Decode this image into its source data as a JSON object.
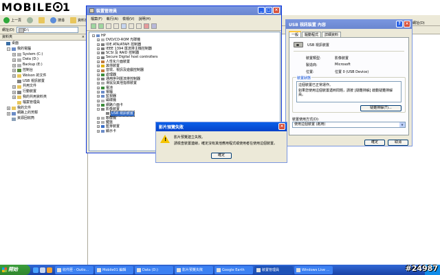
{
  "logo": {
    "text_left": "MOBILE",
    "text_right": "1"
  },
  "explorer": {
    "back": "上一頁",
    "search": "搜尋",
    "folders": "資料夾",
    "address_label": "網址(D)",
    "address_value": "D:\\",
    "pane_title": "資料夾",
    "pane_close": "×",
    "tree": [
      {
        "label": "桌面",
        "indent": 0,
        "box": "",
        "color": "#3a6ea5"
      },
      {
        "label": "我的電腦",
        "indent": 1,
        "box": "−",
        "color": "#6b8cc7"
      },
      {
        "label": "System (C:)",
        "indent": 2,
        "box": "+",
        "color": "#b0b0b0"
      },
      {
        "label": "Data (D:)",
        "indent": 2,
        "box": "+",
        "color": "#b0b0b0"
      },
      {
        "label": "Backup (E:)",
        "indent": 2,
        "box": "+",
        "color": "#b0b0b0"
      },
      {
        "label": "控制台",
        "indent": 2,
        "box": "+",
        "color": "#5b8c3a"
      },
      {
        "label": "Wolson 的文件",
        "indent": 2,
        "box": "+",
        "color": "#e8c65c"
      },
      {
        "label": "USB 視訊裝置",
        "indent": 2,
        "box": "",
        "color": "#808080"
      },
      {
        "label": "共用文件",
        "indent": 2,
        "box": "+",
        "color": "#e8c65c"
      },
      {
        "label": "行動裝置",
        "indent": 2,
        "box": "+",
        "color": "#808080"
      },
      {
        "label": "我的共用資料夾",
        "indent": 2,
        "box": "+",
        "color": "#e8c65c"
      },
      {
        "label": "檔案管理員",
        "indent": 2,
        "box": "",
        "color": "#e8c65c"
      },
      {
        "label": "我的文件",
        "indent": 1,
        "box": "+",
        "color": "#e8c65c"
      },
      {
        "label": "網路上的芳鄰",
        "indent": 1,
        "box": "+",
        "color": "#6b8cc7"
      },
      {
        "label": "資源回收筒",
        "indent": 1,
        "box": "",
        "color": "#8aa0b8"
      }
    ]
  },
  "device_manager": {
    "title": "裝置管理員",
    "menu": [
      "檔案(F)",
      "執行(A)",
      "檢視(V)",
      "說明(H)"
    ],
    "tree": [
      {
        "label": "HP",
        "indent": 0,
        "box": "−",
        "color": "#6b8cc7"
      },
      {
        "label": "DVD/CD-ROM 光碟機",
        "indent": 1,
        "box": "+",
        "color": "#b0b0b0"
      },
      {
        "label": "IDE ATA/ATAPI 控制器",
        "indent": 1,
        "box": "+",
        "color": "#7d7d7d"
      },
      {
        "label": "IEEE 1394 匯流排主機控制器",
        "indent": 1,
        "box": "+",
        "color": "#7d7d7d"
      },
      {
        "label": "SCSI 及 RAID 控制器",
        "indent": 1,
        "box": "+",
        "color": "#7d7d7d"
      },
      {
        "label": "Secure Digital host controllers",
        "indent": 1,
        "box": "+",
        "color": "#7d7d7d"
      },
      {
        "label": "人性化介面裝置",
        "indent": 1,
        "box": "+",
        "color": "#c07a3c"
      },
      {
        "label": "其他裝置",
        "indent": 1,
        "box": "+",
        "color": "#e0b000"
      },
      {
        "label": "音效、視訊及遊戲控制器",
        "indent": 1,
        "box": "+",
        "color": "#c07a3c"
      },
      {
        "label": "處理器",
        "indent": 1,
        "box": "+",
        "color": "#3a8c3a"
      },
      {
        "label": "通用序列匯流排控制器",
        "indent": 1,
        "box": "+",
        "color": "#7d7d7d"
      },
      {
        "label": "滑鼠及其他指標裝置",
        "indent": 1,
        "box": "+",
        "color": "#b0b0b0"
      },
      {
        "label": "電池",
        "indent": 1,
        "box": "+",
        "color": "#3a8c3a"
      },
      {
        "label": "電腦",
        "indent": 1,
        "box": "+",
        "color": "#6b8cc7"
      },
      {
        "label": "監視器",
        "indent": 1,
        "box": "+",
        "color": "#6b8cc7"
      },
      {
        "label": "磁碟機",
        "indent": 1,
        "box": "+",
        "color": "#b0b0b0"
      },
      {
        "label": "網路介面卡",
        "indent": 1,
        "box": "+",
        "color": "#3a8c3a"
      },
      {
        "label": "影像裝置",
        "indent": 1,
        "box": "−",
        "color": "#808080"
      },
      {
        "label": "USB 視訊裝置",
        "indent": 2,
        "box": "",
        "color": "#808080",
        "selected": true
      },
      {
        "label": "軟碟機",
        "indent": 1,
        "box": "+",
        "color": "#b0b0b0"
      },
      {
        "label": "鍵盤",
        "indent": 1,
        "box": "+",
        "color": "#b0b0b0"
      },
      {
        "label": "藍芽裝置",
        "indent": 1,
        "box": "+",
        "color": "#3a6ec7"
      },
      {
        "label": "顯示卡",
        "indent": 1,
        "box": "+",
        "color": "#6b8cc7"
      }
    ]
  },
  "properties": {
    "title": "USB 視訊裝置 內容",
    "tabs": [
      "一般",
      "驅動程式",
      "詳細資料"
    ],
    "device_name": "USB 視訊裝置",
    "fields": [
      {
        "key": "裝置類型:",
        "value": "影像裝置"
      },
      {
        "key": "製造商:",
        "value": "Microsoft"
      },
      {
        "key": "位置:",
        "value": "位置 0 (USB Device)"
      }
    ],
    "status_group": "裝置狀態",
    "status_text": "這個裝置已正常運作。",
    "status_text2": "如果您使用這個裝置遇到問題，請按 [疑難排解] 啟動疑難排解員。",
    "troubleshoot": "疑難排解(T)...",
    "usage_label": "裝置使用方式(D):",
    "usage_value": "使用這個裝置 (啟用)",
    "ok": "確定",
    "cancel": "取消"
  },
  "dialog": {
    "title": "影片預覽失敗",
    "line1": "影片預覽建立失敗。",
    "line2": "請檢查裝置連線，確定沒有其他應用程式或使用者在使用這個裝置。",
    "ok": "確定"
  },
  "right_window": {
    "label": "網址(D)"
  },
  "taskbar": {
    "start": "開始",
    "tasks": [
      {
        "label": "收件匣 - Outlo...",
        "active": false
      },
      {
        "label": "Mobile01 編輯",
        "active": false
      },
      {
        "label": "Data (D:)",
        "active": false
      },
      {
        "label": "影片預覽失敗",
        "active": false
      },
      {
        "label": "Google Earth",
        "active": false
      },
      {
        "label": "裝置管理員",
        "active": true
      },
      {
        "label": "Windows Live ...",
        "active": false
      }
    ]
  },
  "watermark": "#24987"
}
